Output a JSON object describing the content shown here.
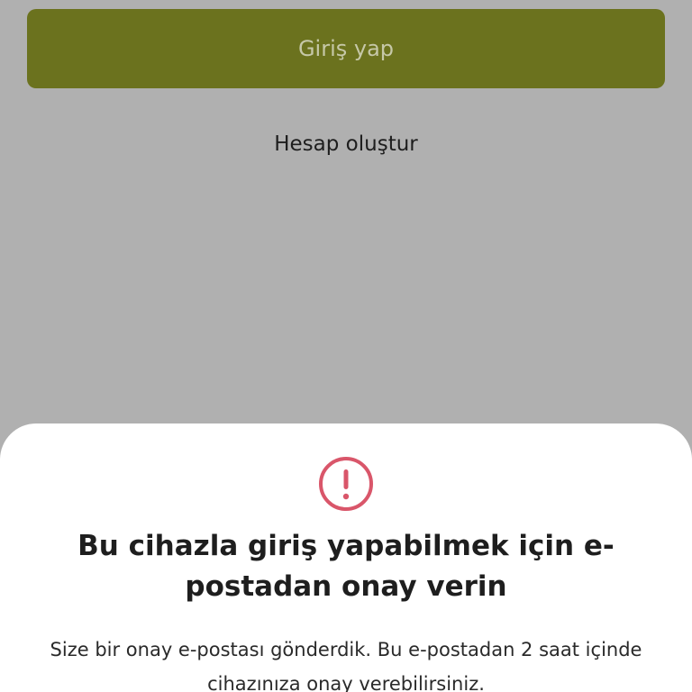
{
  "login": {
    "button_label": "Giriş yap",
    "create_account_label": "Hesap oluştur"
  },
  "sheet": {
    "icon": "alert-circle-icon",
    "title": "Bu cihazla giriş yapabilmek için e-postadan onay verin",
    "message": "Size bir onay e-postası gönderdik. Bu e-postadan 2 saat içinde cihazınıza onay verebilirsiniz."
  },
  "colors": {
    "primary_button": "#6b721e",
    "backdrop": "#b0b0b0",
    "alert": "#d9566a"
  }
}
